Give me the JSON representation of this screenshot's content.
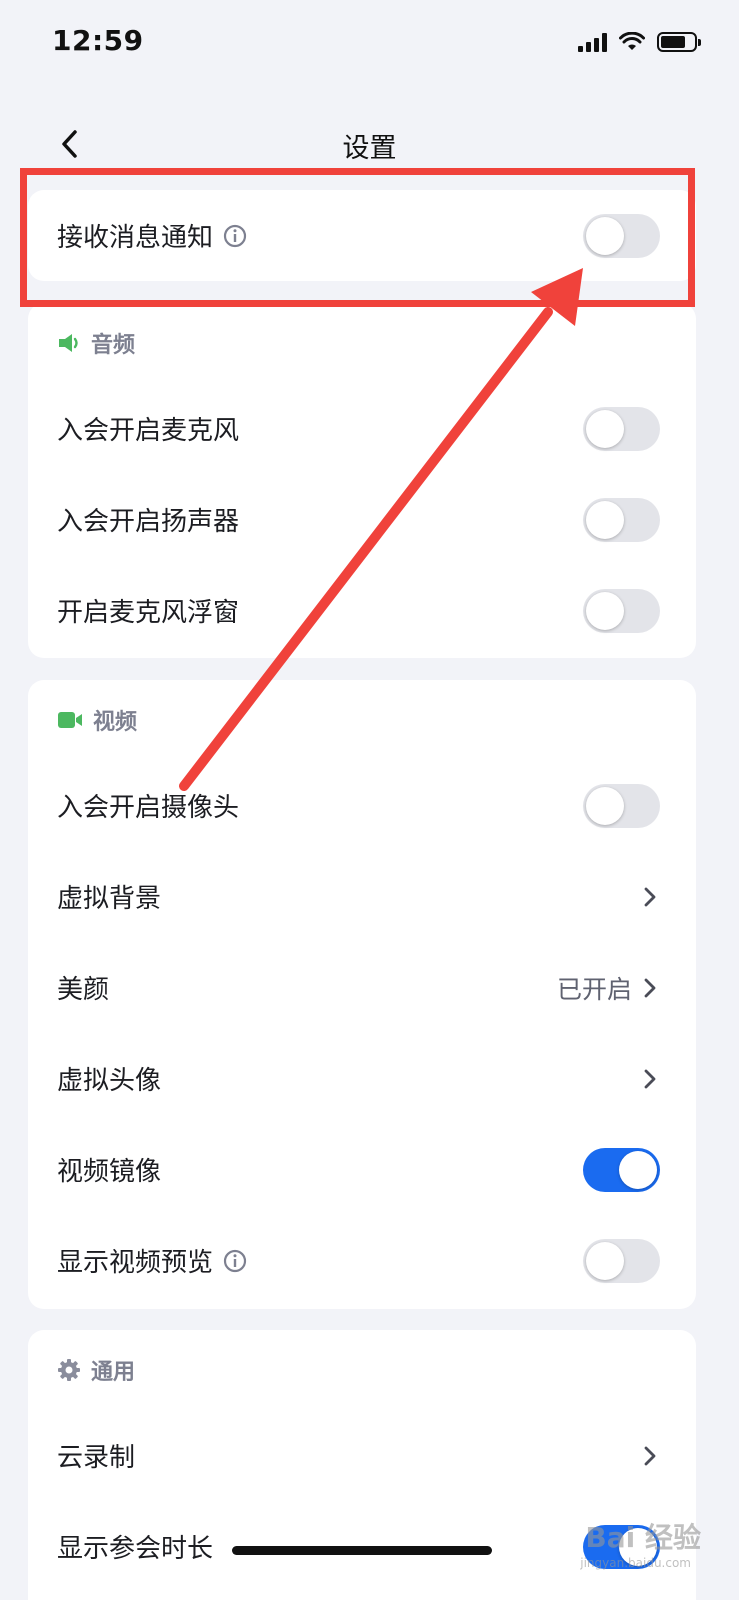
{
  "status_bar": {
    "time": "12:59"
  },
  "nav": {
    "title": "设置"
  },
  "notification": {
    "label": "接收消息通知",
    "enabled": false
  },
  "audio": {
    "header": "音频",
    "items": [
      {
        "label": "入会开启麦克风",
        "enabled": false
      },
      {
        "label": "入会开启扬声器",
        "enabled": false
      },
      {
        "label": "开启麦克风浮窗",
        "enabled": false
      }
    ]
  },
  "video": {
    "header": "视频",
    "camera": {
      "label": "入会开启摄像头",
      "enabled": false
    },
    "virtual_bg": {
      "label": "虚拟背景"
    },
    "beauty": {
      "label": "美颜",
      "value": "已开启"
    },
    "virtual_avatar": {
      "label": "虚拟头像"
    },
    "mirror": {
      "label": "视频镜像",
      "enabled": true
    },
    "preview": {
      "label": "显示视频预览",
      "enabled": false
    }
  },
  "general": {
    "header": "通用",
    "cloud_record": {
      "label": "云录制"
    },
    "show_duration": {
      "label": "显示参会时长",
      "enabled": true
    }
  },
  "watermark": {
    "text": "Bai 经验",
    "sub": "jingyan.baidu.com"
  },
  "colors": {
    "accent": "#1a6bf0",
    "annotation": "#f0423b",
    "audio_icon": "#4cb860",
    "video_icon": "#4cb860",
    "general_icon": "#8a8d9c"
  },
  "icons": {
    "back": "chevron-left-icon",
    "info": "info-icon",
    "chevron": "chevron-right-icon",
    "audio": "speaker-icon",
    "video": "camera-icon",
    "general": "gear-icon"
  }
}
